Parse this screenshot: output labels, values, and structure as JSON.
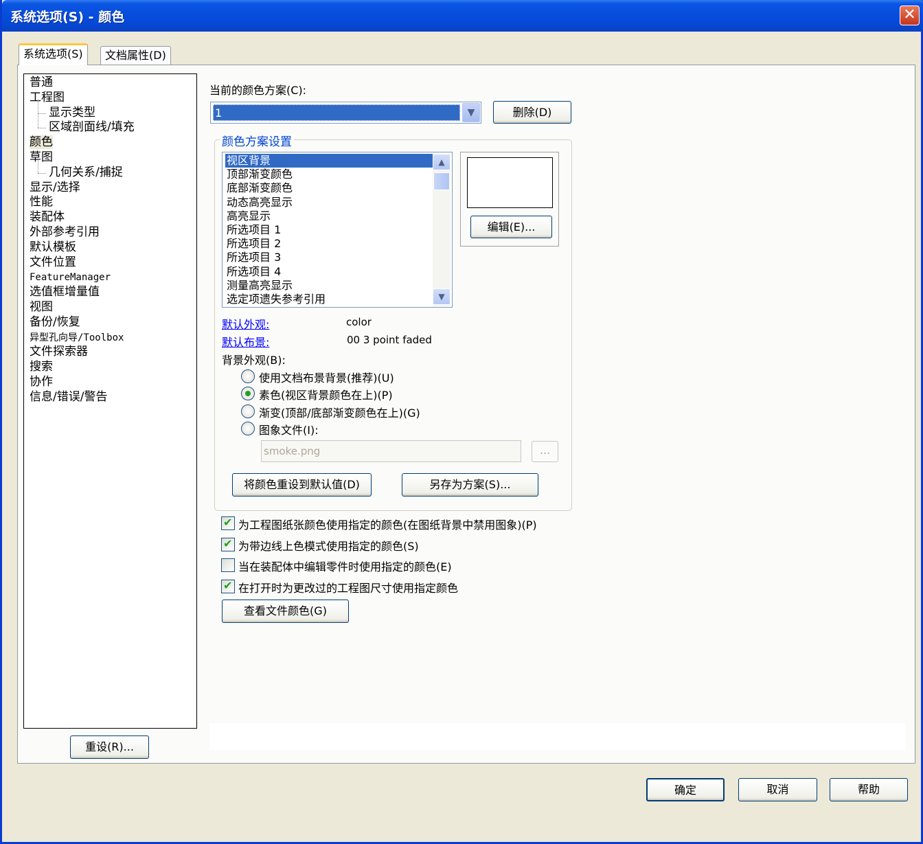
{
  "window": {
    "title": "系统选项(S) - 颜色",
    "close_glyph": "✕"
  },
  "tabs": [
    {
      "label": "系统选项(S)",
      "active": true
    },
    {
      "label": "文档属性(D)",
      "active": false
    }
  ],
  "tree": {
    "items": [
      {
        "label": "普通",
        "level": 0
      },
      {
        "label": "工程图",
        "level": 0
      },
      {
        "label": "显示类型",
        "level": 1
      },
      {
        "label": "区域剖面线/填充",
        "level": 1
      },
      {
        "label": "颜色",
        "level": 0,
        "selected": true
      },
      {
        "label": "草图",
        "level": 0
      },
      {
        "label": "几何关系/捕捉",
        "level": 1
      },
      {
        "label": "显示/选择",
        "level": 0
      },
      {
        "label": "性能",
        "level": 0
      },
      {
        "label": "装配体",
        "level": 0
      },
      {
        "label": "外部参考引用",
        "level": 0
      },
      {
        "label": "默认模板",
        "level": 0
      },
      {
        "label": "文件位置",
        "level": 0
      },
      {
        "label": "FeatureManager",
        "level": 0
      },
      {
        "label": "选值框增量值",
        "level": 0
      },
      {
        "label": "视图",
        "level": 0
      },
      {
        "label": "备份/恢复",
        "level": 0
      },
      {
        "label": "异型孔向导/Toolbox",
        "level": 0
      },
      {
        "label": "文件探索器",
        "level": 0
      },
      {
        "label": "搜索",
        "level": 0
      },
      {
        "label": "协作",
        "level": 0
      },
      {
        "label": "信息/错误/警告",
        "level": 0
      }
    ]
  },
  "reset_button": "重设(R)...",
  "scheme": {
    "label": "当前的颜色方案(C):",
    "value": "1",
    "delete_button": "删除(D)"
  },
  "group": {
    "legend": "颜色方案设置",
    "items": [
      "视区背景",
      "顶部渐变颜色",
      "底部渐变颜色",
      "动态高亮显示",
      "高亮显示",
      "所选项目 1",
      "所选项目 2",
      "所选项目 3",
      "所选项目 4",
      "测量高亮显示",
      "选定项遗失参考引用"
    ],
    "selected_index": 0,
    "preview_color": "#ffffff",
    "edit_button": "编辑(E)...",
    "default_appearance_label": "默认外观:",
    "default_appearance_value": "color",
    "default_scene_label": "默认布景:",
    "default_scene_value": "00 3 point faded",
    "bg_label": "背景外观(B):",
    "radios": [
      {
        "label": "使用文档布景背景(推荐)(U)",
        "checked": false
      },
      {
        "label": "素色(视区背景颜色在上)(P)",
        "checked": true
      },
      {
        "label": "渐变(顶部/底部渐变颜色在上)(G)",
        "checked": false
      },
      {
        "label": "图象文件(I):",
        "checked": false
      }
    ],
    "image_file": "smoke.png",
    "browse_button": "...",
    "reset_colors_button": "将颜色重设到默认值(D)",
    "save_scheme_button": "另存为方案(S)..."
  },
  "checkboxes": [
    {
      "label": "为工程图纸张颜色使用指定的颜色(在图纸背景中禁用图象)(P)",
      "checked": true
    },
    {
      "label": "为带边线上色模式使用指定的颜色(S)",
      "checked": true
    },
    {
      "label": "当在装配体中编辑零件时使用指定的颜色(E)",
      "checked": false
    },
    {
      "label": "在打开时为更改过的工程图尺寸使用指定颜色",
      "checked": true
    }
  ],
  "view_file_colors_button": "查看文件颜色(G)",
  "footer": {
    "ok": "确定",
    "cancel": "取消",
    "help": "帮助"
  },
  "colors": {
    "titlebar": "#0549d8",
    "selection": "#316ac5",
    "dialog_bg": "#ece9d8",
    "link": "#0000ff"
  }
}
